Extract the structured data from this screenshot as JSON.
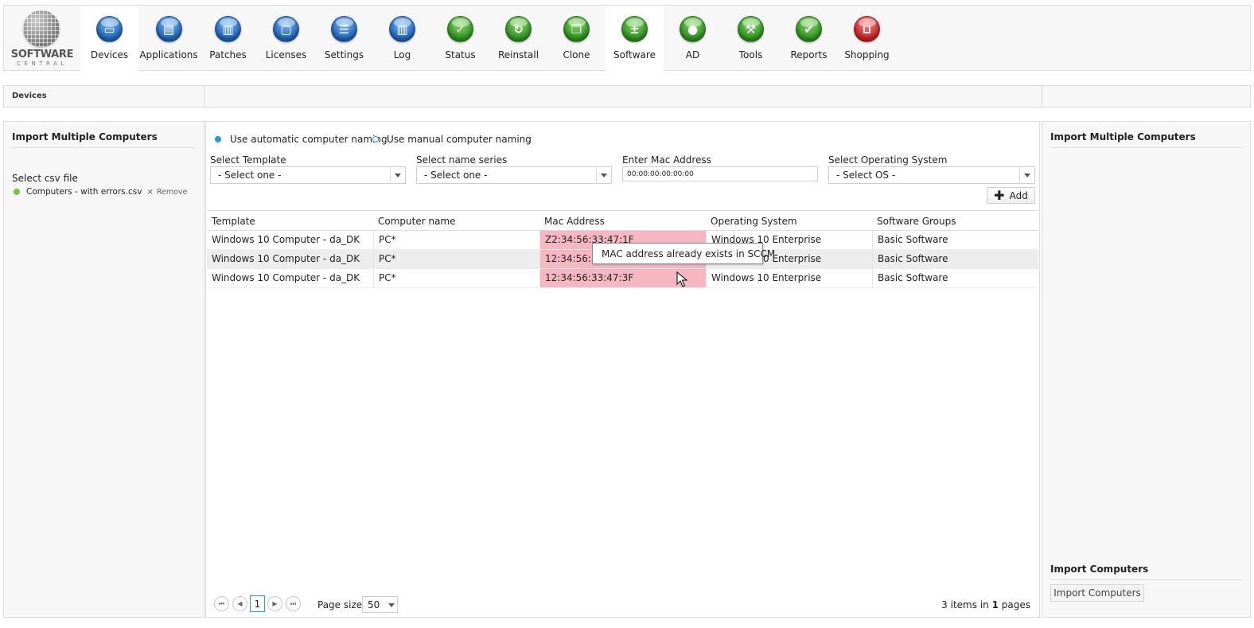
{
  "logo": {
    "line1": "SOFTWARE",
    "line2": "CENTRAL"
  },
  "nav": [
    {
      "label": "Devices",
      "icon": "monitor-icon",
      "color": "blue",
      "active": true
    },
    {
      "label": "Applications",
      "icon": "applications-icon",
      "color": "blue"
    },
    {
      "label": "Patches",
      "icon": "patches-icon",
      "color": "blue"
    },
    {
      "label": "Licenses",
      "icon": "licenses-icon",
      "color": "blue"
    },
    {
      "label": "Settings",
      "icon": "settings-icon",
      "color": "blue"
    },
    {
      "label": "Log",
      "icon": "log-icon",
      "color": "blue"
    },
    {
      "label": "Status",
      "icon": "checkmark-icon",
      "color": "green"
    },
    {
      "label": "Reinstall",
      "icon": "reinstall-icon",
      "color": "green"
    },
    {
      "label": "Clone",
      "icon": "clone-icon",
      "color": "green"
    },
    {
      "label": "Software",
      "icon": "software-icon",
      "color": "green",
      "active": true
    },
    {
      "label": "AD",
      "icon": "ad-users-icon",
      "color": "green"
    },
    {
      "label": "Tools",
      "icon": "wrench-icon",
      "color": "green"
    },
    {
      "label": "Reports",
      "icon": "reports-icon",
      "color": "green"
    },
    {
      "label": "Shopping",
      "icon": "shopping-cart-icon",
      "color": "red"
    }
  ],
  "breadcrumb": {
    "current": "Devices"
  },
  "left_panel": {
    "title": "Import Multiple Computers",
    "csv_label": "Select csv file",
    "file_name": "Computers - with errors.csv",
    "remove_icon": "×",
    "remove_label": "Remove"
  },
  "center": {
    "naming": {
      "auto_label": "Use automatic computer naming",
      "manual_label": "Use manual computer naming",
      "selected": "auto"
    },
    "fields": {
      "template_label": "Select Template",
      "template_value": "- Select one -",
      "name_series_label": "Select name series",
      "name_series_value": "- Select one -",
      "mac_label": "Enter Mac Address",
      "mac_value": "00:00:00:00:00:00",
      "os_label": "Select Operating System",
      "os_value": "- Select OS -"
    },
    "add_button": "Add",
    "table": {
      "columns": [
        "Template",
        "Computer name",
        "Mac Address",
        "Operating System",
        "Software Groups"
      ],
      "rows": [
        [
          "Windows 10 Computer - da_DK",
          "PC*",
          "Z2:34:56:33:47:1F",
          "Windows 10 Enterprise",
          "Basic Software"
        ],
        [
          "Windows 10 Computer - da_DK",
          "PC*",
          "12:34:56:33:47:1F",
          "Windows 10 Enterprise",
          "Basic Software"
        ],
        [
          "Windows 10 Computer - da_DK",
          "PC*",
          "12:34:56:33:47:3F",
          "Windows 10 Enterprise",
          "Basic Software"
        ]
      ]
    },
    "tooltip": "MAC address already exists in SCCM",
    "pager": {
      "current_page": "1",
      "page_size_label": "Page size:",
      "page_size": "50",
      "items_count": "3",
      "items_text": "items in",
      "pages_count": "1",
      "pages_text": "pages"
    }
  },
  "right_panel": {
    "title": "Import Multiple Computers",
    "import_title": "Import Computers",
    "import_button": "Import Computers"
  },
  "colors": {
    "accent": "#2a9ad6",
    "error_cell": "#f7b7c2",
    "status_dot": "#7cc142"
  }
}
